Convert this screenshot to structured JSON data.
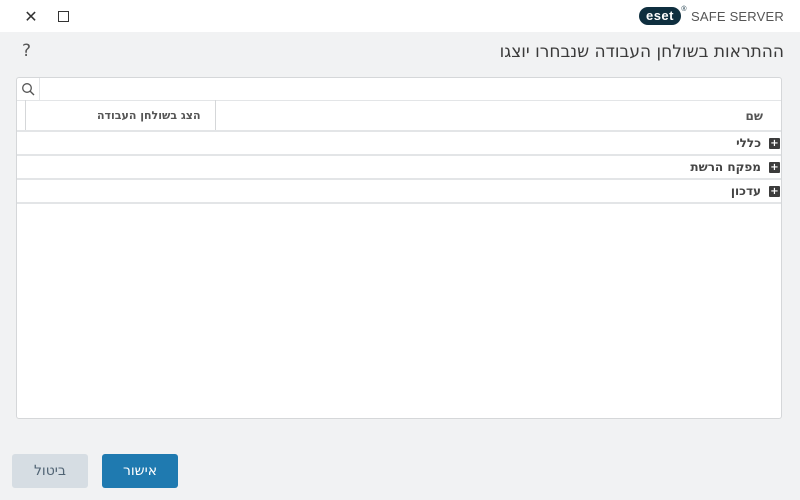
{
  "window": {
    "close_glyph": "✕",
    "brand_logo": "eset",
    "brand_registered": "®",
    "brand_product": "SAFE SERVER"
  },
  "header": {
    "help_glyph": "?",
    "title": "ההתראות בשולחן העבודה שנבחרו יוצגו"
  },
  "table": {
    "search_placeholder": "",
    "columns": {
      "name": "שם",
      "show_on_desktop": "הצג בשולחן העבודה"
    },
    "groups": [
      {
        "label": "כללי",
        "expand_glyph": "+"
      },
      {
        "label": "מפקח הרשת",
        "expand_glyph": "+"
      },
      {
        "label": "עדכון",
        "expand_glyph": "+"
      }
    ]
  },
  "footer": {
    "ok_label": "אישור",
    "cancel_label": "ביטול"
  },
  "colors": {
    "primary": "#1f7ab0",
    "secondary": "#d6dde3",
    "brand": "#0f2f3f",
    "background": "#f1f2f3"
  }
}
